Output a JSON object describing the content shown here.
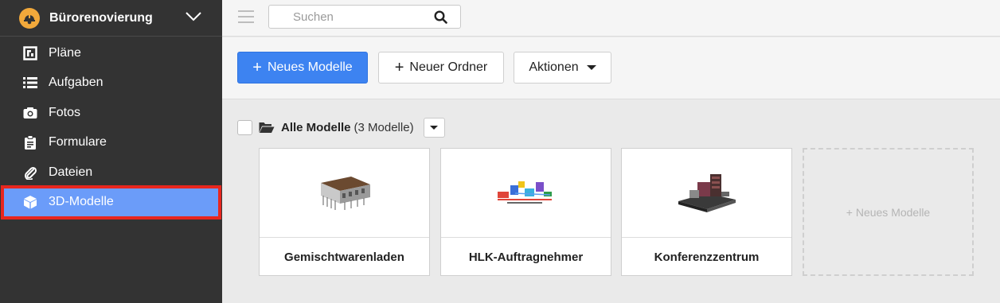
{
  "project": {
    "name": "Bürorenovierung",
    "logo_icon": "hard-hat-icon"
  },
  "sidebar": {
    "items": [
      {
        "label": "Pläne",
        "icon": "plans-icon"
      },
      {
        "label": "Aufgaben",
        "icon": "list-icon"
      },
      {
        "label": "Fotos",
        "icon": "camera-icon"
      },
      {
        "label": "Formulare",
        "icon": "clipboard-icon"
      },
      {
        "label": "Dateien",
        "icon": "paperclip-icon"
      },
      {
        "label": "3D-Modelle",
        "icon": "cube-icon",
        "active": true
      }
    ]
  },
  "topbar": {
    "search_placeholder": "Suchen"
  },
  "toolbar": {
    "new_model_label": "Neues Modelle",
    "new_folder_label": "Neuer Ordner",
    "actions_label": "Aktionen"
  },
  "folder": {
    "title": "Alle Modelle",
    "count": "(3 Modelle)"
  },
  "models": [
    {
      "name": "Gemischtwarenladen"
    },
    {
      "name": "HLK-Auftragnehmer"
    },
    {
      "name": "Konferenzzentrum"
    }
  ],
  "new_model_card": "+ Neues Modelle",
  "colors": {
    "sidebar_bg": "#333333",
    "active_item": "#6b9cf9",
    "highlight_border": "#e8261e",
    "primary_button": "#3d83f1",
    "logo": "#f2a93b"
  }
}
